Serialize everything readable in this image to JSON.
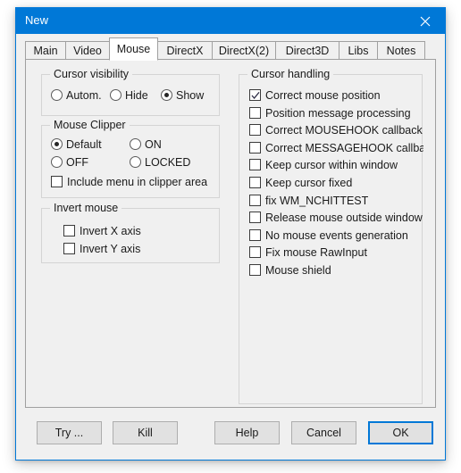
{
  "window": {
    "title": "New",
    "close_icon": "close-icon"
  },
  "tabs": [
    {
      "label": "Main",
      "selected": false
    },
    {
      "label": "Video",
      "selected": false
    },
    {
      "label": "Mouse",
      "selected": true
    },
    {
      "label": "DirectX",
      "selected": false
    },
    {
      "label": "DirectX(2)",
      "selected": false
    },
    {
      "label": "Direct3D",
      "selected": false
    },
    {
      "label": "Libs",
      "selected": false
    },
    {
      "label": "Notes",
      "selected": false
    }
  ],
  "groups": {
    "cursor_visibility": {
      "title": "Cursor visibility",
      "options": [
        {
          "label": "Autom.",
          "checked": false
        },
        {
          "label": "Hide",
          "checked": false
        },
        {
          "label": "Show",
          "checked": true
        }
      ]
    },
    "mouse_clipper": {
      "title": "Mouse Clipper",
      "options": [
        {
          "label": "Default",
          "checked": true
        },
        {
          "label": "ON",
          "checked": false
        },
        {
          "label": "OFF",
          "checked": false
        },
        {
          "label": "LOCKED",
          "checked": false
        }
      ],
      "include_menu": {
        "label": "Include menu in clipper area",
        "checked": false
      }
    },
    "invert_mouse": {
      "title": "Invert mouse",
      "options": [
        {
          "label": "Invert X axis",
          "checked": false
        },
        {
          "label": "Invert Y axis",
          "checked": false
        }
      ]
    },
    "cursor_handling": {
      "title": "Cursor handling",
      "options": [
        {
          "label": "Correct mouse position",
          "checked": true
        },
        {
          "label": "Position message processing",
          "checked": false
        },
        {
          "label": "Correct MOUSEHOOK callback",
          "checked": false
        },
        {
          "label": "Correct MESSAGEHOOK callback",
          "checked": false
        },
        {
          "label": "Keep cursor within window",
          "checked": false
        },
        {
          "label": "Keep cursor fixed",
          "checked": false
        },
        {
          "label": "fix WM_NCHITTEST",
          "checked": false
        },
        {
          "label": "Release mouse outside window",
          "checked": false
        },
        {
          "label": "No mouse events generation",
          "checked": false
        },
        {
          "label": "Fix mouse RawInput",
          "checked": false
        },
        {
          "label": "Mouse shield",
          "checked": false
        }
      ]
    }
  },
  "buttons": [
    {
      "label": "Try ...",
      "default": false
    },
    {
      "label": "Kill",
      "default": false
    },
    {
      "label": "Help",
      "default": false
    },
    {
      "label": "Cancel",
      "default": false
    },
    {
      "label": "OK",
      "default": true
    }
  ],
  "colors": {
    "accent": "#0078d7",
    "window_bg": "#f0f0f0",
    "tab_selected_bg": "#ffffff",
    "button_bg": "#e1e1e1",
    "text": "#1a1a1a"
  }
}
